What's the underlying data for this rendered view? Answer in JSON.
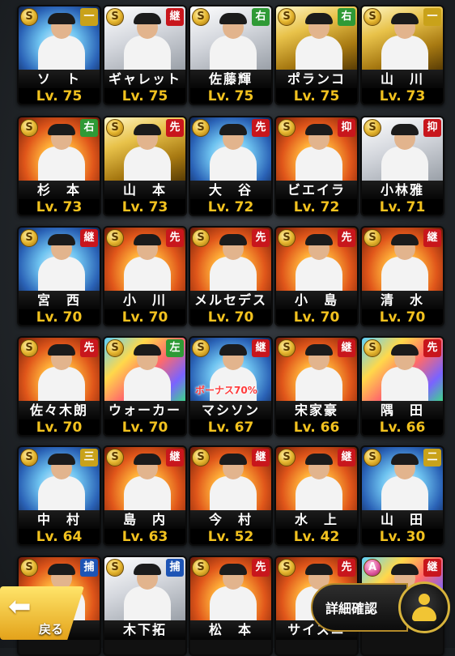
{
  "cards": [
    {
      "name": "ソ　ト",
      "level": "Lv. 75",
      "pos": "一",
      "posColor": "yellow",
      "badge": "S",
      "art": "blue"
    },
    {
      "name": "ギャレット",
      "level": "Lv. 75",
      "pos": "継",
      "posColor": "red",
      "badge": "S",
      "art": "silver"
    },
    {
      "name": "佐藤輝",
      "level": "Lv. 75",
      "pos": "右",
      "posColor": "green",
      "badge": "S",
      "art": "silver"
    },
    {
      "name": "ポランコ",
      "level": "Lv. 75",
      "pos": "右",
      "posColor": "green",
      "badge": "S",
      "art": "gold"
    },
    {
      "name": "山　川",
      "level": "Lv. 73",
      "pos": "一",
      "posColor": "yellow",
      "badge": "S",
      "art": "gold"
    },
    {
      "name": "杉　本",
      "level": "Lv. 73",
      "pos": "右",
      "posColor": "green",
      "badge": "S",
      "art": "fire"
    },
    {
      "name": "山　本",
      "level": "Lv. 73",
      "pos": "先",
      "posColor": "red",
      "badge": "S",
      "art": "gold"
    },
    {
      "name": "大　谷",
      "level": "Lv. 72",
      "pos": "先",
      "posColor": "red",
      "badge": "S",
      "art": "blue"
    },
    {
      "name": "ビエイラ",
      "level": "Lv. 72",
      "pos": "抑",
      "posColor": "red",
      "badge": "S",
      "art": "fire"
    },
    {
      "name": "小林雅",
      "level": "Lv. 71",
      "pos": "抑",
      "posColor": "red",
      "badge": "S",
      "art": "silver"
    },
    {
      "name": "宮　西",
      "level": "Lv. 70",
      "pos": "継",
      "posColor": "red",
      "badge": "S",
      "art": "blue"
    },
    {
      "name": "小　川",
      "level": "Lv. 70",
      "pos": "先",
      "posColor": "red",
      "badge": "S",
      "art": "fire"
    },
    {
      "name": "メルセデス",
      "level": "Lv. 70",
      "pos": "先",
      "posColor": "red",
      "badge": "S",
      "art": "fire"
    },
    {
      "name": "小　島",
      "level": "Lv. 70",
      "pos": "先",
      "posColor": "red",
      "badge": "S",
      "art": "fire"
    },
    {
      "name": "清　水",
      "level": "Lv. 70",
      "pos": "継",
      "posColor": "red",
      "badge": "S",
      "art": "fire"
    },
    {
      "name": "佐々木朗",
      "level": "Lv. 70",
      "pos": "先",
      "posColor": "red",
      "badge": "S",
      "art": "fire"
    },
    {
      "name": "ウォーカー",
      "level": "Lv. 70",
      "pos": "左",
      "posColor": "green",
      "badge": "S",
      "art": "rainbow"
    },
    {
      "name": "マシソン",
      "level": "Lv. 67",
      "pos": "継",
      "posColor": "red",
      "badge": "S",
      "art": "blue",
      "bonus": "ボーナス70%"
    },
    {
      "name": "宋家豪",
      "level": "Lv. 66",
      "pos": "継",
      "posColor": "red",
      "badge": "S",
      "art": "fire"
    },
    {
      "name": "隅　田",
      "level": "Lv. 66",
      "pos": "先",
      "posColor": "red",
      "badge": "S",
      "art": "rainbow"
    },
    {
      "name": "中　村",
      "level": "Lv. 64",
      "pos": "三",
      "posColor": "yellow",
      "badge": "S",
      "art": "blue"
    },
    {
      "name": "島　内",
      "level": "Lv. 63",
      "pos": "継",
      "posColor": "red",
      "badge": "S",
      "art": "fire"
    },
    {
      "name": "今　村",
      "level": "Lv. 52",
      "pos": "継",
      "posColor": "red",
      "badge": "S",
      "art": "fire"
    },
    {
      "name": "水　上",
      "level": "Lv. 42",
      "pos": "継",
      "posColor": "red",
      "badge": "S",
      "art": "fire"
    },
    {
      "name": "山　田",
      "level": "Lv. 30",
      "pos": "二",
      "posColor": "yellow",
      "badge": "S",
      "art": "blue"
    },
    {
      "name": "",
      "level": "",
      "pos": "捕",
      "posColor": "blue",
      "badge": "S",
      "art": "fire"
    },
    {
      "name": "木下拓",
      "level": "",
      "pos": "捕",
      "posColor": "blue",
      "badge": "S",
      "art": "silver"
    },
    {
      "name": "松　本",
      "level": "",
      "pos": "先",
      "posColor": "red",
      "badge": "S",
      "art": "fire"
    },
    {
      "name": "サイスニ",
      "level": "",
      "pos": "先",
      "posColor": "red",
      "badge": "S",
      "art": "fire"
    },
    {
      "name": "",
      "level": "",
      "pos": "継",
      "posColor": "red",
      "badge": "A",
      "art": "rainbow"
    }
  ],
  "buttons": {
    "back_label": "戻る",
    "detail_label": "詳細確認"
  }
}
